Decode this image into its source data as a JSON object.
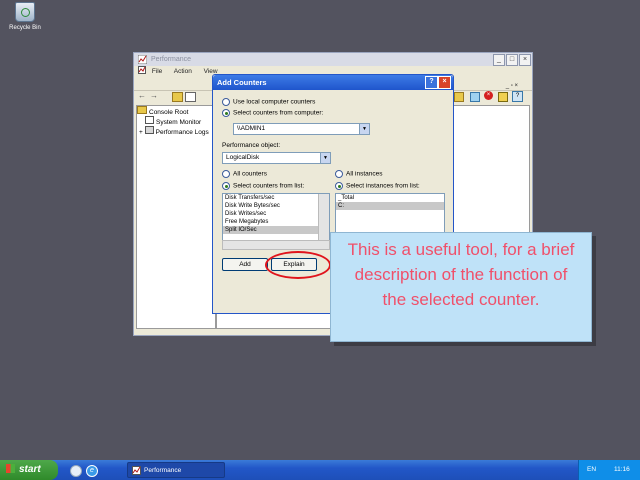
{
  "desktop": {
    "recycle_bin_label": "Recycle Bin"
  },
  "main_window": {
    "title": "Performance",
    "menu": [
      "File",
      "Action",
      "View"
    ],
    "tree": [
      "Console Root",
      "System Monitor",
      "Performance Logs"
    ]
  },
  "dialog": {
    "title": "Add Counters",
    "use_local_label": "Use local computer counters",
    "select_computer_label": "Select counters from computer:",
    "computer_value": "\\\\ADMIN1",
    "perf_object_label": "Performance object:",
    "perf_object_value": "LogicalDisk",
    "all_counters_label": "All counters",
    "select_counters_label": "Select counters from list:",
    "counters": [
      "Disk Transfers/sec",
      "Disk Write Bytes/sec",
      "Disk Writes/sec",
      "Free Megabytes",
      "Split IO/Sec"
    ],
    "selected_counter": "Split IO/Sec",
    "all_instances_label": "All instances",
    "select_instances_label": "Select instances from list:",
    "instances": [
      "_Total",
      "C:"
    ],
    "add_label": "Add",
    "explain_label": "Explain"
  },
  "callout": {
    "text": "This is a useful tool, for a brief description of the function of the selected counter."
  },
  "taskbar": {
    "start_label": "start",
    "task_label": "Performance",
    "lang": "EN",
    "clock": "11:16"
  },
  "colors": {
    "callout_text": "#f0506a",
    "callout_bg": "#bfe2f8",
    "highlight": "#e0141c"
  }
}
